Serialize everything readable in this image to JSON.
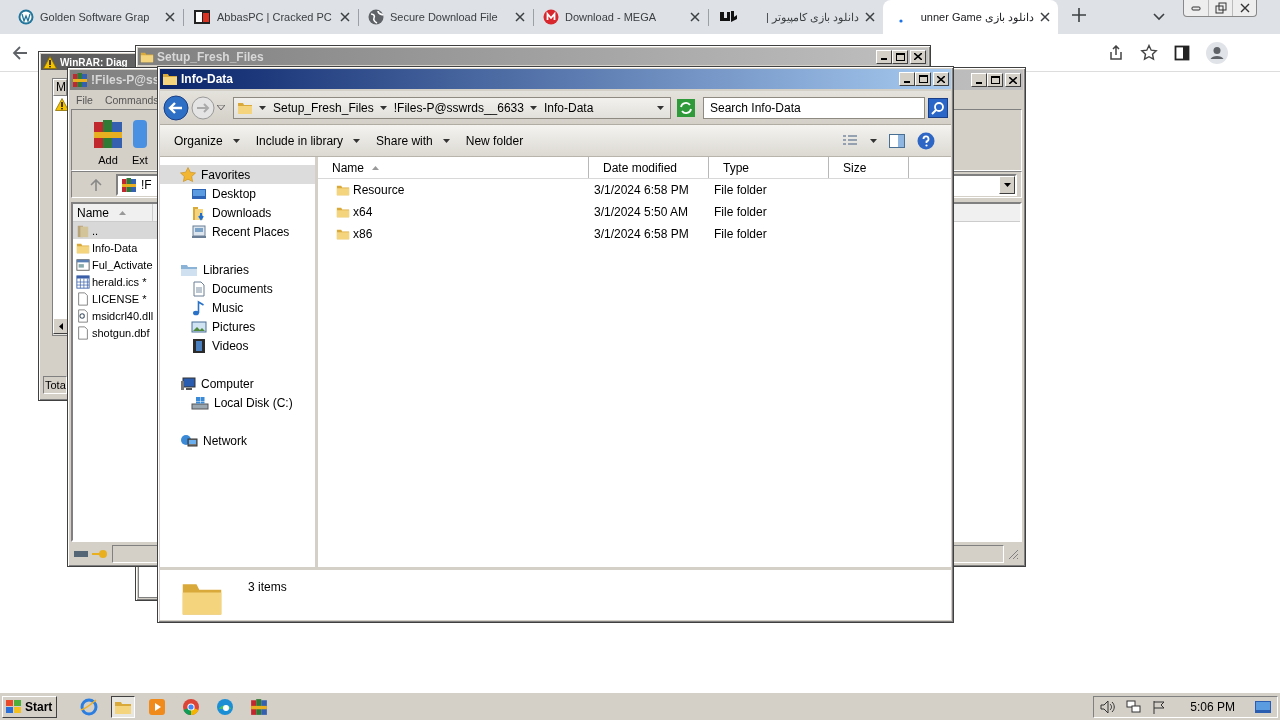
{
  "browser": {
    "tabs": [
      {
        "title": "Golden Software Grap",
        "selected": false
      },
      {
        "title": "AbbasPC | Cracked PC",
        "selected": false
      },
      {
        "title": "Secure Download File",
        "selected": false
      },
      {
        "title": "Download - MEGA",
        "selected": false
      },
      {
        "title": "دانلود بازی کامپیوتر |",
        "selected": false
      },
      {
        "title": "دانلود بازی unner Game",
        "selected": true
      }
    ]
  },
  "windows": {
    "diagnostics": {
      "title": "WinRAR: Diag",
      "active": false,
      "column_1": "M",
      "status": "Tota"
    },
    "setup": {
      "title": "Setup_Fresh_Files",
      "active": false
    },
    "archive": {
      "title": "!Files-P@ss",
      "active": false,
      "menu": [
        "File",
        "Commands"
      ],
      "tools": [
        "Add",
        "Ext"
      ],
      "path": "!F",
      "column": {
        "label": "Name",
        "sorted": true
      },
      "files": [
        {
          "name": "..",
          "selected": true
        },
        {
          "name": "Info-Data",
          "selected": false
        },
        {
          "name": "Ful_Activate",
          "selected": false
        },
        {
          "name": "herald.ics *",
          "selected": false
        },
        {
          "name": "LICENSE *",
          "selected": false
        },
        {
          "name": "msidcrl40.dll",
          "selected": false
        },
        {
          "name": "shotgun.dbf",
          "selected": false
        }
      ]
    },
    "explorer": {
      "title": "Info-Data",
      "active": true,
      "breadcrumb": [
        "Setup_Fresh_Files",
        "!Files-P@sswrds__6633",
        "Info-Data"
      ],
      "search": {
        "placeholder": "Search Info-Data"
      },
      "commands": [
        {
          "label": "Organize",
          "dropdown": true
        },
        {
          "label": "Include in library",
          "dropdown": true
        },
        {
          "label": "Share with",
          "dropdown": true
        },
        {
          "label": "New folder",
          "dropdown": false
        }
      ],
      "nav": [
        {
          "label": "Favorites",
          "selected": true,
          "children": [
            {
              "label": "Desktop",
              "selected": false
            },
            {
              "label": "Downloads",
              "selected": false
            },
            {
              "label": "Recent Places",
              "selected": false
            }
          ]
        },
        {
          "label": "Libraries",
          "selected": false,
          "children": [
            {
              "label": "Documents",
              "selected": false
            },
            {
              "label": "Music",
              "selected": false
            },
            {
              "label": "Pictures",
              "selected": false
            },
            {
              "label": "Videos",
              "selected": false
            }
          ]
        },
        {
          "label": "Computer",
          "selected": false,
          "children": [
            {
              "label": "Local Disk (C:)",
              "selected": false
            }
          ]
        },
        {
          "label": "Network",
          "selected": false
        }
      ],
      "columns": [
        {
          "label": "Name",
          "sorted": true
        },
        {
          "label": "Date modified",
          "sorted": false
        },
        {
          "label": "Type",
          "sorted": false
        },
        {
          "label": "Size",
          "sorted": false
        }
      ],
      "rows": [
        {
          "name": "Resource",
          "date": "3/1/2024 6:58 PM",
          "type": "File folder"
        },
        {
          "name": "x64",
          "date": "3/1/2024 5:50 AM",
          "type": "File folder"
        },
        {
          "name": "x86",
          "date": "3/1/2024 6:58 PM",
          "type": "File folder"
        }
      ],
      "status": "3 items"
    }
  },
  "taskbar": {
    "start": "Start",
    "clock": "5:06 PM"
  }
}
